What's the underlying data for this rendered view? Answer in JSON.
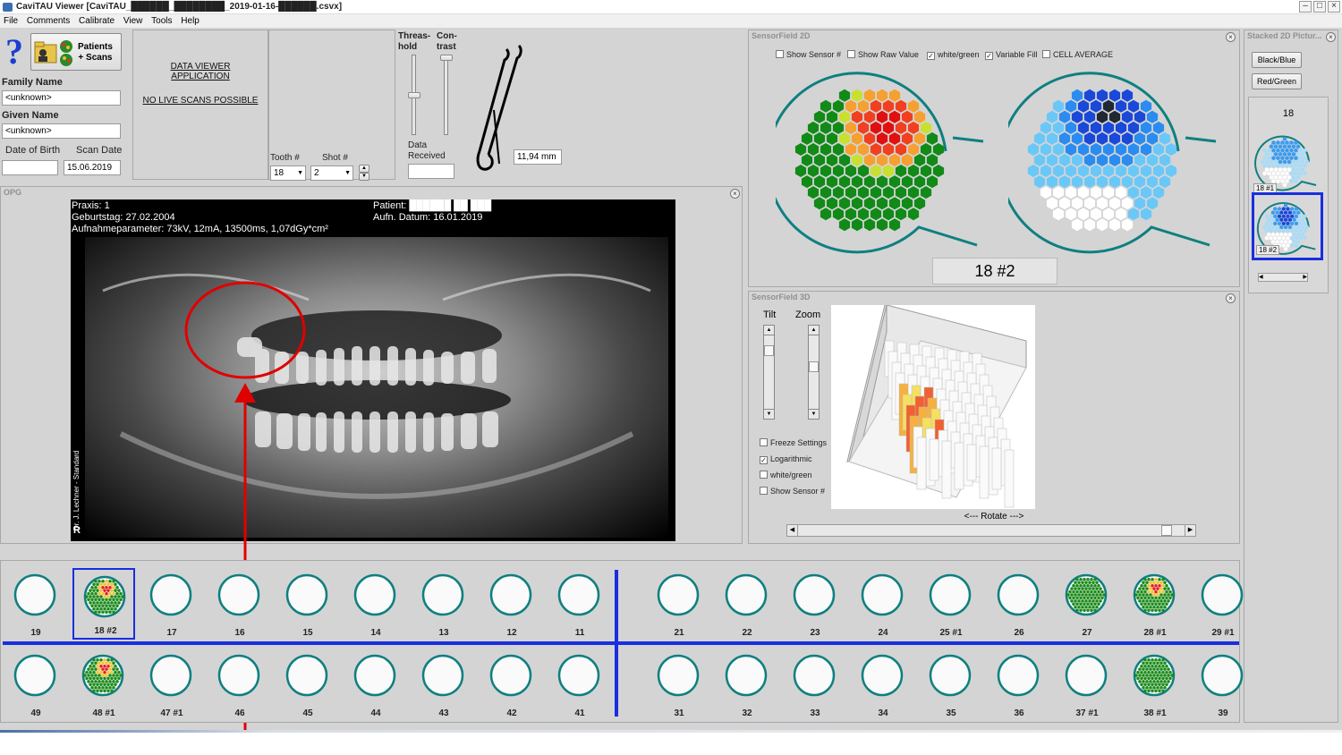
{
  "window": {
    "title": "CaviTAU Viewer [CaviTAU_██████_████████_2019-01-16-██████.csvx]"
  },
  "menu": [
    "File",
    "Comments",
    "Calibrate",
    "View",
    "Tools",
    "Help"
  ],
  "patient": {
    "patients_button": "Patients\n+ Scans",
    "family_name_label": "Family Name",
    "family_name_value": "<unknown>",
    "given_name_label": "Given Name",
    "given_name_value": "<unknown>",
    "dob_label": "Date of Birth",
    "dob_value": "",
    "scan_date_label": "Scan Date",
    "scan_date_value": "15.06.2019"
  },
  "info": {
    "line1": "DATA VIEWER APPLICATION",
    "line2": "NO LIVE SCANS POSSIBLE"
  },
  "controls": {
    "tooth_label": "Tooth #",
    "tooth_value": "18",
    "shot_label": "Shot #",
    "shot_value": "2",
    "threshold_label": "Threas-\nhold",
    "contrast_label": "Con-\ntrast",
    "data_received_label": "Data\nReceived",
    "data_received_value": "",
    "probe_length": "11,94 mm"
  },
  "opg": {
    "title": "OPG",
    "praxis": "Praxis: 1",
    "geburtstag": "Geburtstag: 27.02.2004",
    "params": "Aufnahmeparameter: 73kV, 12mA, 13500ms, 1,07dGy*cm²",
    "patient": "Patient: ██████ ██ ███",
    "aufn": "Aufn. Datum: 16.01.2019",
    "side_text": "Dr. J. Lechner - Standard",
    "r_mark": "R"
  },
  "sensor2d": {
    "title": "SensorField 2D",
    "options": [
      {
        "label": "Show Sensor #",
        "checked": false
      },
      {
        "label": "Show Raw Value",
        "checked": false
      },
      {
        "label": "white/green",
        "checked": true
      },
      {
        "label": "Variable Fill",
        "checked": true
      },
      {
        "label": "CELL AVERAGE",
        "checked": false
      }
    ],
    "caption": "18 #2"
  },
  "sensor3d": {
    "title": "SensorField 3D",
    "tilt_label": "Tilt",
    "zoom_label": "Zoom",
    "options": [
      {
        "label": "Freeze Settings",
        "checked": false
      },
      {
        "label": "Logarithmic",
        "checked": true
      },
      {
        "label": "white/green",
        "checked": false
      },
      {
        "label": "Show Sensor #",
        "checked": false
      }
    ],
    "rotate_label": "<--- Rotate --->"
  },
  "stacked": {
    "title": "Stacked 2D Pictur...",
    "btn_black_blue": "Black/Blue",
    "btn_red_green": "Red/Green",
    "tooth": "18",
    "thumbs": [
      "18 #1",
      "18 #2"
    ]
  },
  "teeth_upper": [
    "19",
    "18 #2",
    "17",
    "16",
    "15",
    "14",
    "13",
    "12",
    "11",
    "21",
    "22",
    "23",
    "24",
    "25 #1",
    "26",
    "27",
    "28 #1",
    "29 #1"
  ],
  "teeth_lower": [
    "49",
    "48 #1",
    "47 #1",
    "46",
    "45",
    "44",
    "43",
    "42",
    "41",
    "31",
    "32",
    "33",
    "34",
    "35",
    "36",
    "37 #1",
    "38 #1",
    "39"
  ]
}
